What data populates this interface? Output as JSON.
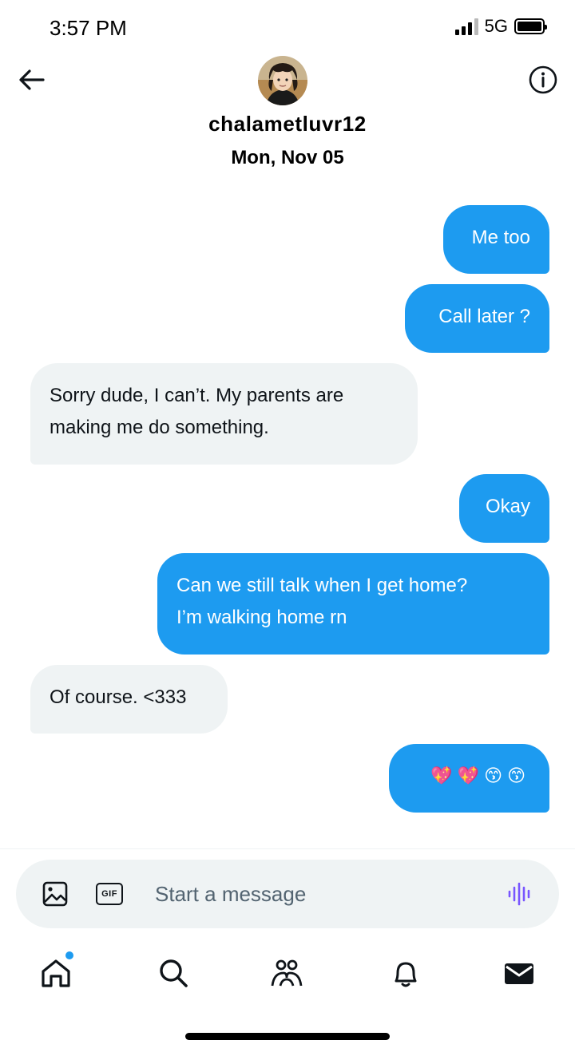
{
  "status_bar": {
    "time": "3:57 PM",
    "network": "5G"
  },
  "header": {
    "username": "chalametluvr12",
    "date": "Mon, Nov 05",
    "back_icon": "arrow-left-icon",
    "info_icon": "info-circle-icon"
  },
  "messages": [
    {
      "direction": "sent",
      "text": "Me too"
    },
    {
      "direction": "sent",
      "text": "Call later ?"
    },
    {
      "direction": "received",
      "lines": [
        "Sorry dude, I can’t. My parents are",
        "making me do something."
      ]
    },
    {
      "direction": "sent",
      "text": "Okay"
    },
    {
      "direction": "sent",
      "lines": [
        "Can we still talk when I get home?",
        "I’m walking home rn"
      ]
    },
    {
      "direction": "received",
      "text": "Of course. <333"
    },
    {
      "direction": "sent",
      "text": "💖💖😙😙"
    }
  ],
  "composer": {
    "placeholder": "Start a message",
    "media_icon": "image-icon",
    "gif_label": "GIF",
    "voice_icon": "voice-waveform-icon"
  },
  "tabs": [
    "home-icon",
    "search-icon",
    "communities-icon",
    "bell-icon",
    "mail-icon"
  ],
  "colors": {
    "accent": "#1d9bf0",
    "received_bubble": "#eff3f4",
    "voice": "#7856ff"
  }
}
